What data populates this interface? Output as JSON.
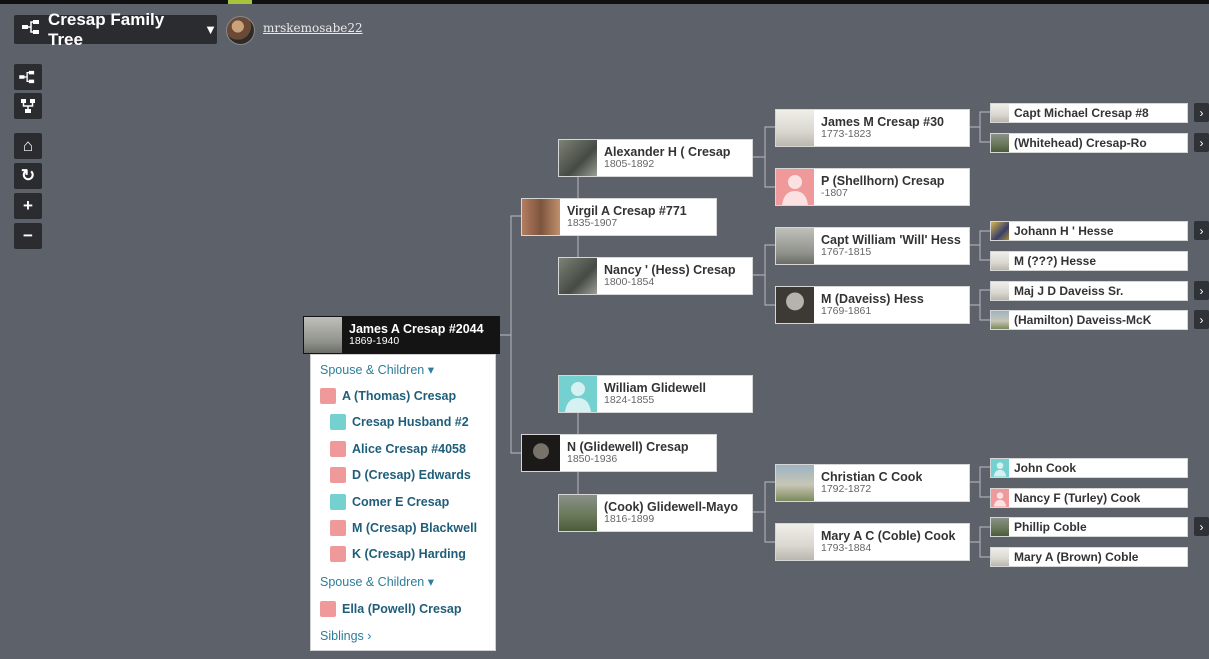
{
  "header": {
    "tree_title": "Cresap Family Tree",
    "username": "mrskemosabe22"
  },
  "toolbar": {
    "tools": [
      {
        "icon": "pedigree-view-icon",
        "glyph": "⊏"
      },
      {
        "icon": "descendants-view-icon",
        "glyph": "Y"
      },
      {
        "icon": "home-icon",
        "glyph": "⌂"
      },
      {
        "icon": "refresh-icon",
        "glyph": "↻"
      },
      {
        "icon": "zoom-in-icon",
        "glyph": "+"
      },
      {
        "icon": "zoom-out-icon",
        "glyph": "−"
      }
    ]
  },
  "root": {
    "name": "James A Cresap #2044",
    "dates": "1869-1940"
  },
  "parents": [
    {
      "name": "Virgil A Cresap #771",
      "dates": "1835-1907"
    },
    {
      "name": "N (Glidewell) Cresap",
      "dates": "1850-1936"
    }
  ],
  "grandparents": [
    {
      "name": "Alexander H ( Cresap",
      "dates": "1805-1892"
    },
    {
      "name": "Nancy ' (Hess) Cresap",
      "dates": "1800-1854"
    },
    {
      "name": "William Glidewell",
      "dates": "1824-1855"
    },
    {
      "name": "(Cook) Glidewell-Mayo",
      "dates": "1816-1899"
    }
  ],
  "great_grandparents": [
    {
      "name": "James M Cresap #30",
      "dates": "1773-1823"
    },
    {
      "name": "P (Shellhorn) Cresap",
      "dates": "-1807"
    },
    {
      "name": "Capt William 'Will' Hess",
      "dates": "1767-1815"
    },
    {
      "name": "M (Daveiss) Hess",
      "dates": "1769-1861"
    },
    {
      "name": "Christian C Cook",
      "dates": "1792-1872"
    },
    {
      "name": "Mary A C (Coble) Cook",
      "dates": "1793-1884"
    }
  ],
  "gen5": [
    {
      "name": "Capt Michael Cresap #8",
      "expandable": true
    },
    {
      "name": "(Whitehead) Cresap-Ro",
      "expandable": true
    },
    {
      "name": "Johann H ' Hesse",
      "expandable": true
    },
    {
      "name": "M (???) Hesse",
      "expandable": false
    },
    {
      "name": "Maj J D Daveiss Sr.",
      "expandable": true
    },
    {
      "name": "(Hamilton) Daveiss-McK",
      "expandable": true
    },
    {
      "name": "John Cook",
      "expandable": false
    },
    {
      "name": "Nancy F (Turley) Cook",
      "expandable": false
    },
    {
      "name": "Phillip Coble",
      "expandable": true
    },
    {
      "name": "Mary A (Brown) Coble",
      "expandable": false
    }
  ],
  "family_panel": {
    "spouse_children_label_1": "Spouse & Children",
    "spouse_1": "A (Thomas) Cresap",
    "children": [
      "Cresap Husband #2",
      "Alice Cresap #4058",
      "D (Cresap) Edwards",
      "Comer E Cresap",
      "M (Cresap) Blackwell",
      "K (Cresap) Harding"
    ],
    "spouse_children_label_2": "Spouse & Children",
    "spouse_2": "Ella (Powell) Cresap",
    "siblings_label": "Siblings"
  },
  "colors": {
    "background": "#5d6169",
    "female_silhouette": "#f0999a",
    "male_silhouette": "#74d1cf",
    "link": "#1f5e7a",
    "accent": "#a6c53c"
  }
}
